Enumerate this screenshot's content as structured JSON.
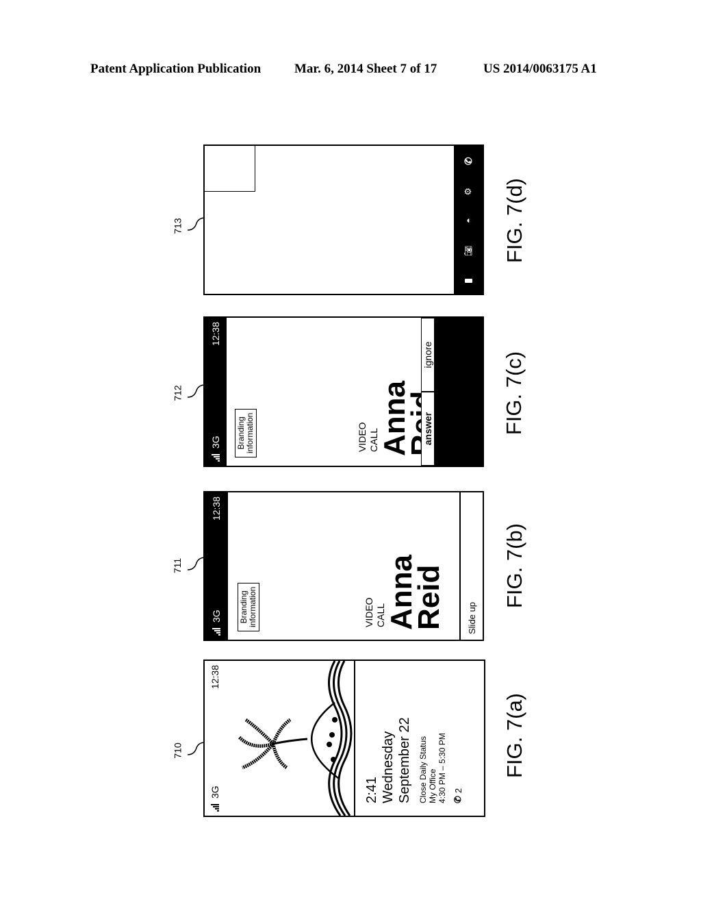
{
  "header": {
    "publication": "Patent Application Publication",
    "date_sheet": "Mar. 6, 2014   Sheet 7 of 17",
    "number": "US 2014/0063175 A1"
  },
  "figures": {
    "a": {
      "label": "FIG. 7(a)",
      "ref": "710",
      "status": {
        "network": "3G",
        "time": "12:38"
      },
      "lock": {
        "time": "2:41",
        "day": "Wednesday",
        "date": "September 22",
        "event_title": "Close Daily Status",
        "event_location": "My Office",
        "event_time": "4:30 PM – 5:30 PM",
        "missed_calls": "2"
      }
    },
    "b": {
      "label": "FIG. 7(b)",
      "ref": "711",
      "status": {
        "network": "3G",
        "time": "12:38"
      },
      "branding": [
        "Branding",
        "information"
      ],
      "call_type": [
        "VIDEO",
        "CALL"
      ],
      "caller": [
        "Anna",
        "Reid"
      ],
      "slide_label": "Slide up"
    },
    "c": {
      "label": "FIG. 7(c)",
      "ref": "712",
      "status": {
        "network": "3G",
        "time": "12:38"
      },
      "branding": [
        "Branding",
        "information"
      ],
      "call_type": [
        "VIDEO",
        "CALL"
      ],
      "caller": [
        "Anna",
        "Reid"
      ],
      "answer_label": "answer",
      "ignore_label": "ignore"
    },
    "d": {
      "label": "FIG. 7(d)",
      "ref": "713",
      "controls": [
        "end-call",
        "switch-camera",
        "speaker",
        "camera-off",
        "mute"
      ]
    }
  }
}
